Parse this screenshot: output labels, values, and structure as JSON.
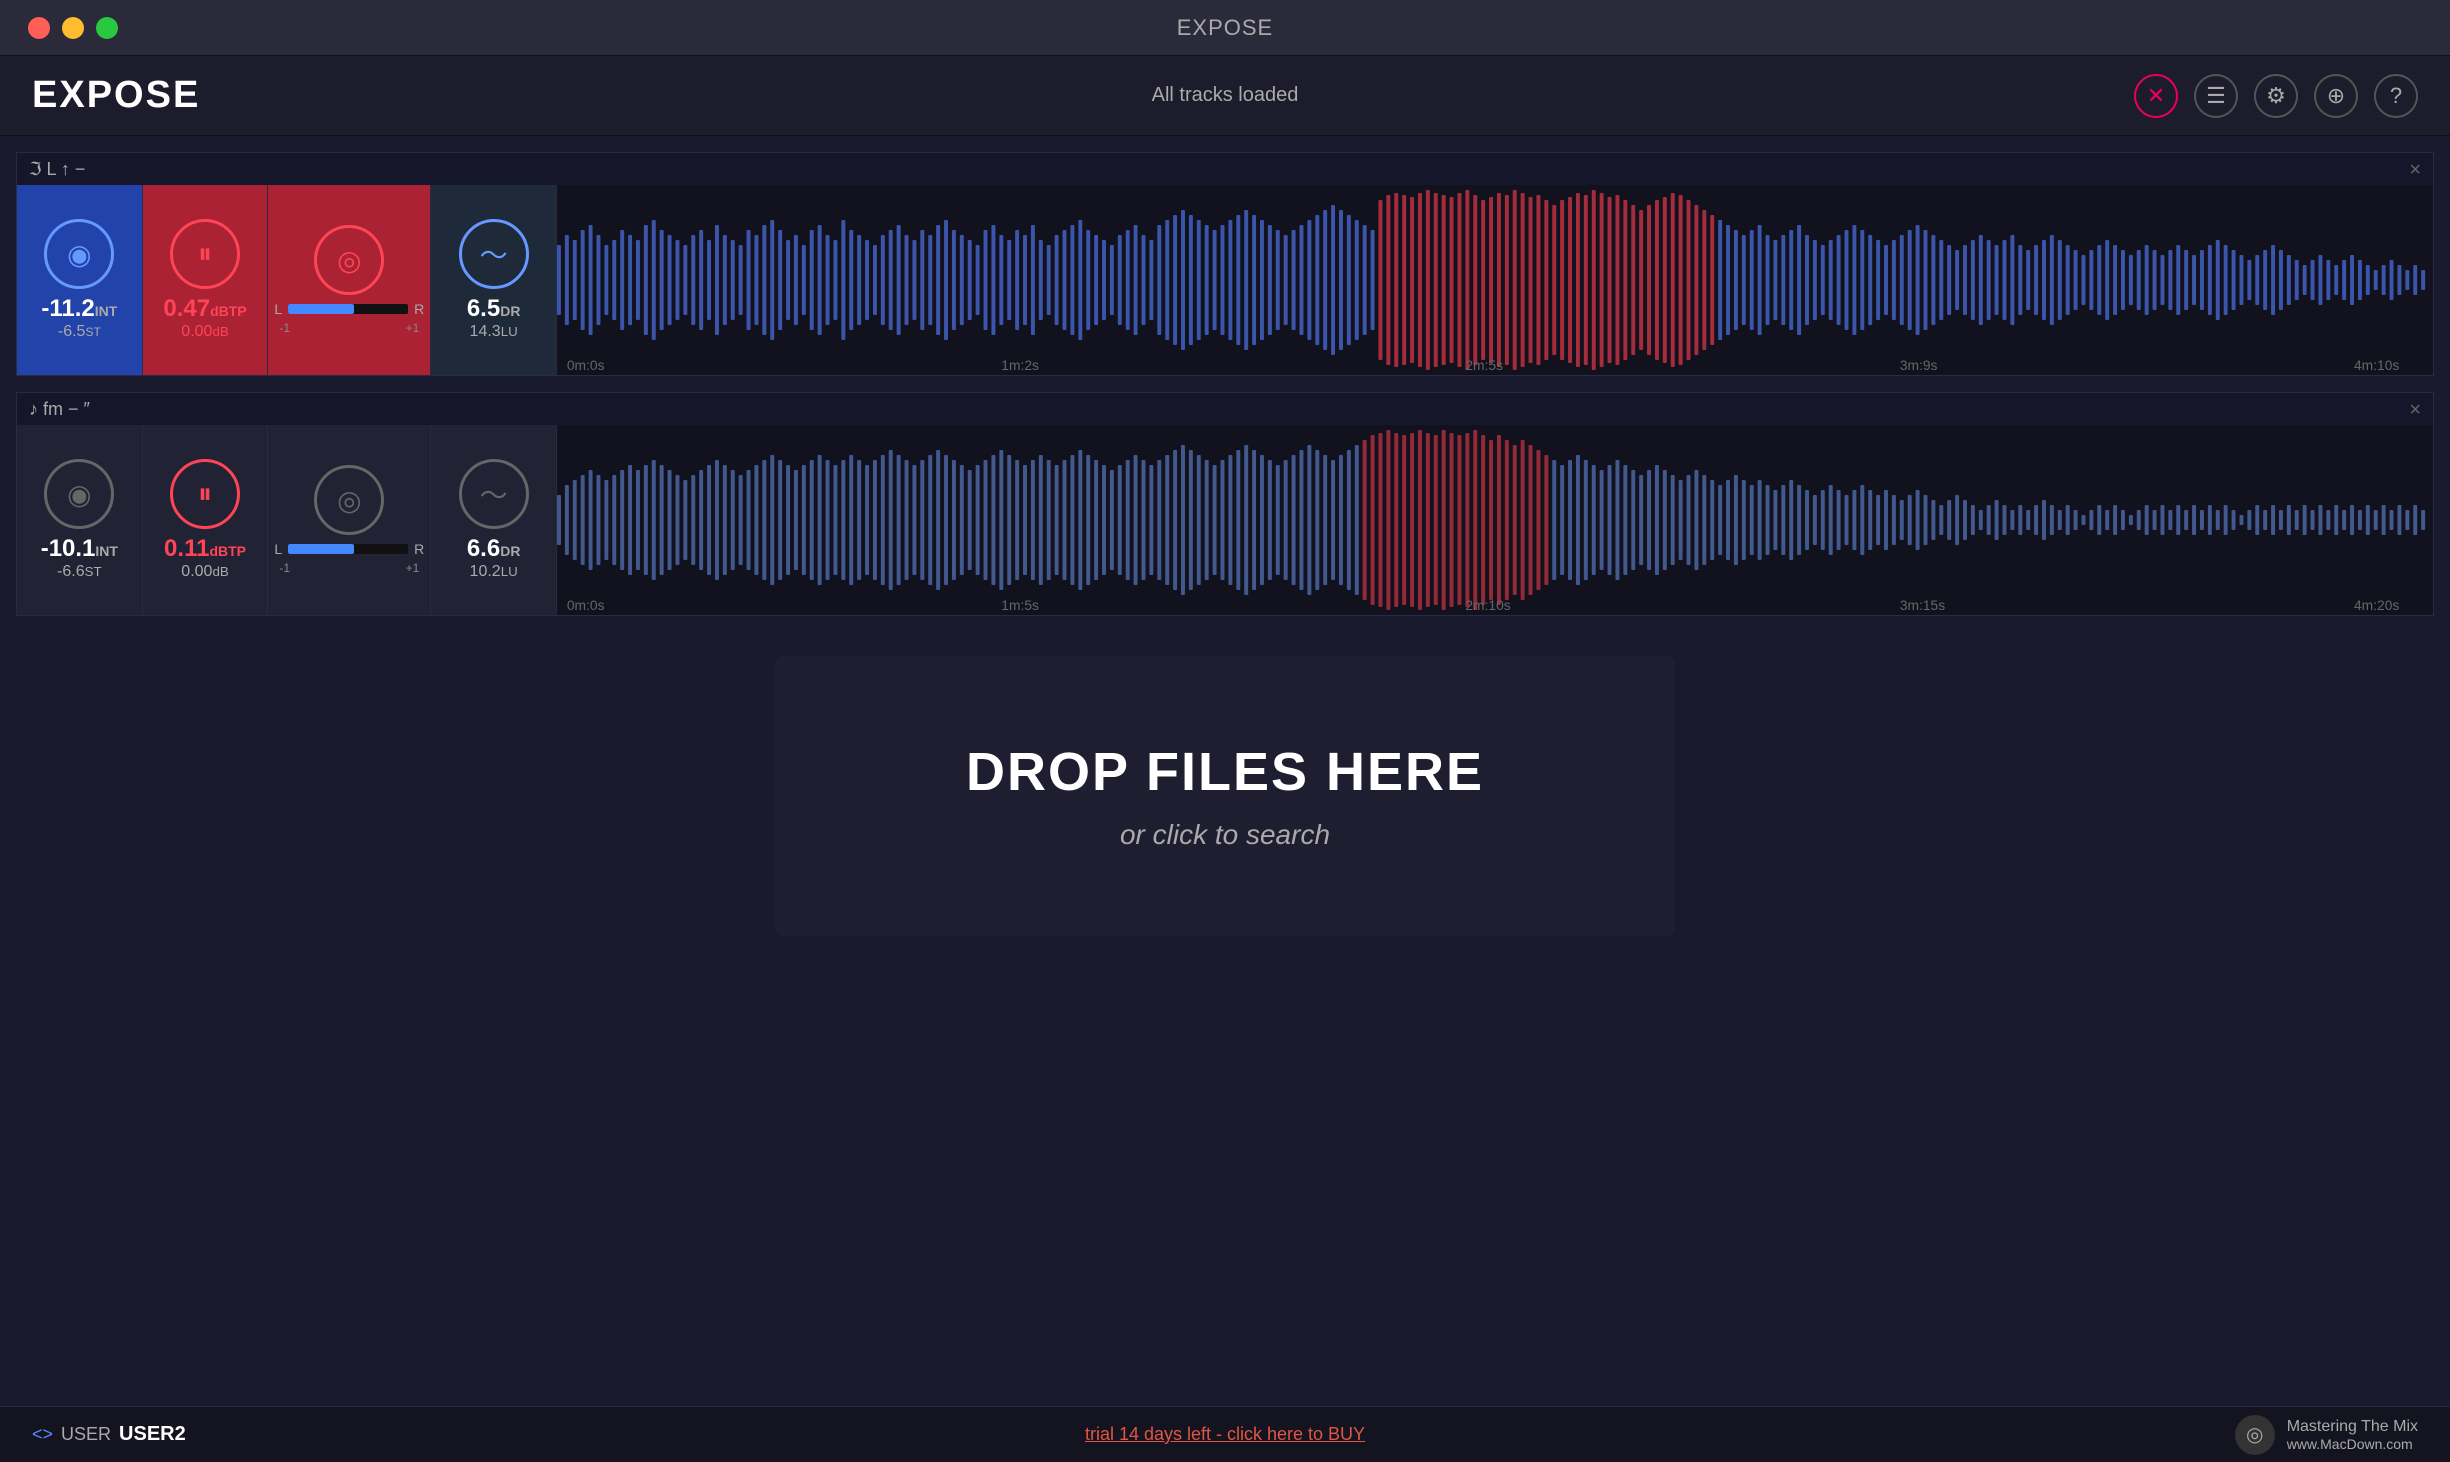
{
  "window": {
    "title": "EXPOSE",
    "controls": [
      "close",
      "minimize",
      "maximize"
    ]
  },
  "header": {
    "app_title": "EXPOSE",
    "status": "All tracks loaded",
    "icons": [
      "close-red",
      "list",
      "gear",
      "filter",
      "question"
    ]
  },
  "track1": {
    "header_text": "ℑ L  ↑  −",
    "active": true,
    "metrics": {
      "loudness": {
        "value": "-11.2",
        "unit": "INT",
        "sub": "-6.5",
        "sub_unit": "ST"
      },
      "tp": {
        "value": "0.47",
        "unit": "dBTP",
        "sub_value": "0.00",
        "sub_unit": "dB"
      },
      "stereo": {
        "left_label": "L",
        "right_label": "R",
        "neg_label": "-1",
        "pos_label": "+1"
      },
      "dr": {
        "value": "6.5",
        "unit": "DR",
        "sub_value": "14.3",
        "sub_unit": "LU"
      }
    },
    "timeline": [
      "0m:0s",
      "1m:2s",
      "2m:5s",
      "3m:9s",
      "4m:10s"
    ]
  },
  "track2": {
    "header_text": "♪ fm −  ″",
    "metrics": {
      "loudness": {
        "value": "-10.1",
        "unit": "INT",
        "sub": "-6.6",
        "sub_unit": "ST"
      },
      "tp": {
        "value": "0.11",
        "unit": "dBTP",
        "sub_value": "0.00",
        "sub_unit": "dB"
      },
      "stereo": {
        "left_label": "L",
        "right_label": "R",
        "neg_label": "-1",
        "pos_label": "+1"
      },
      "dr": {
        "value": "6.6",
        "unit": "DR",
        "sub_value": "10.2",
        "sub_unit": "LU"
      }
    },
    "timeline": [
      "0m:0s",
      "1m:5s",
      "2m:10s",
      "3m:15s",
      "4m:20s"
    ]
  },
  "drop_zone": {
    "title": "DROP FILES HERE",
    "subtitle": "or click to search"
  },
  "footer": {
    "user_prefix": "USER",
    "user_name": "USER2",
    "trial_text": "trial 14 days left - click here to BUY",
    "brand_name": "Mastering The Mix",
    "brand_url": "www.MacDown.com"
  }
}
